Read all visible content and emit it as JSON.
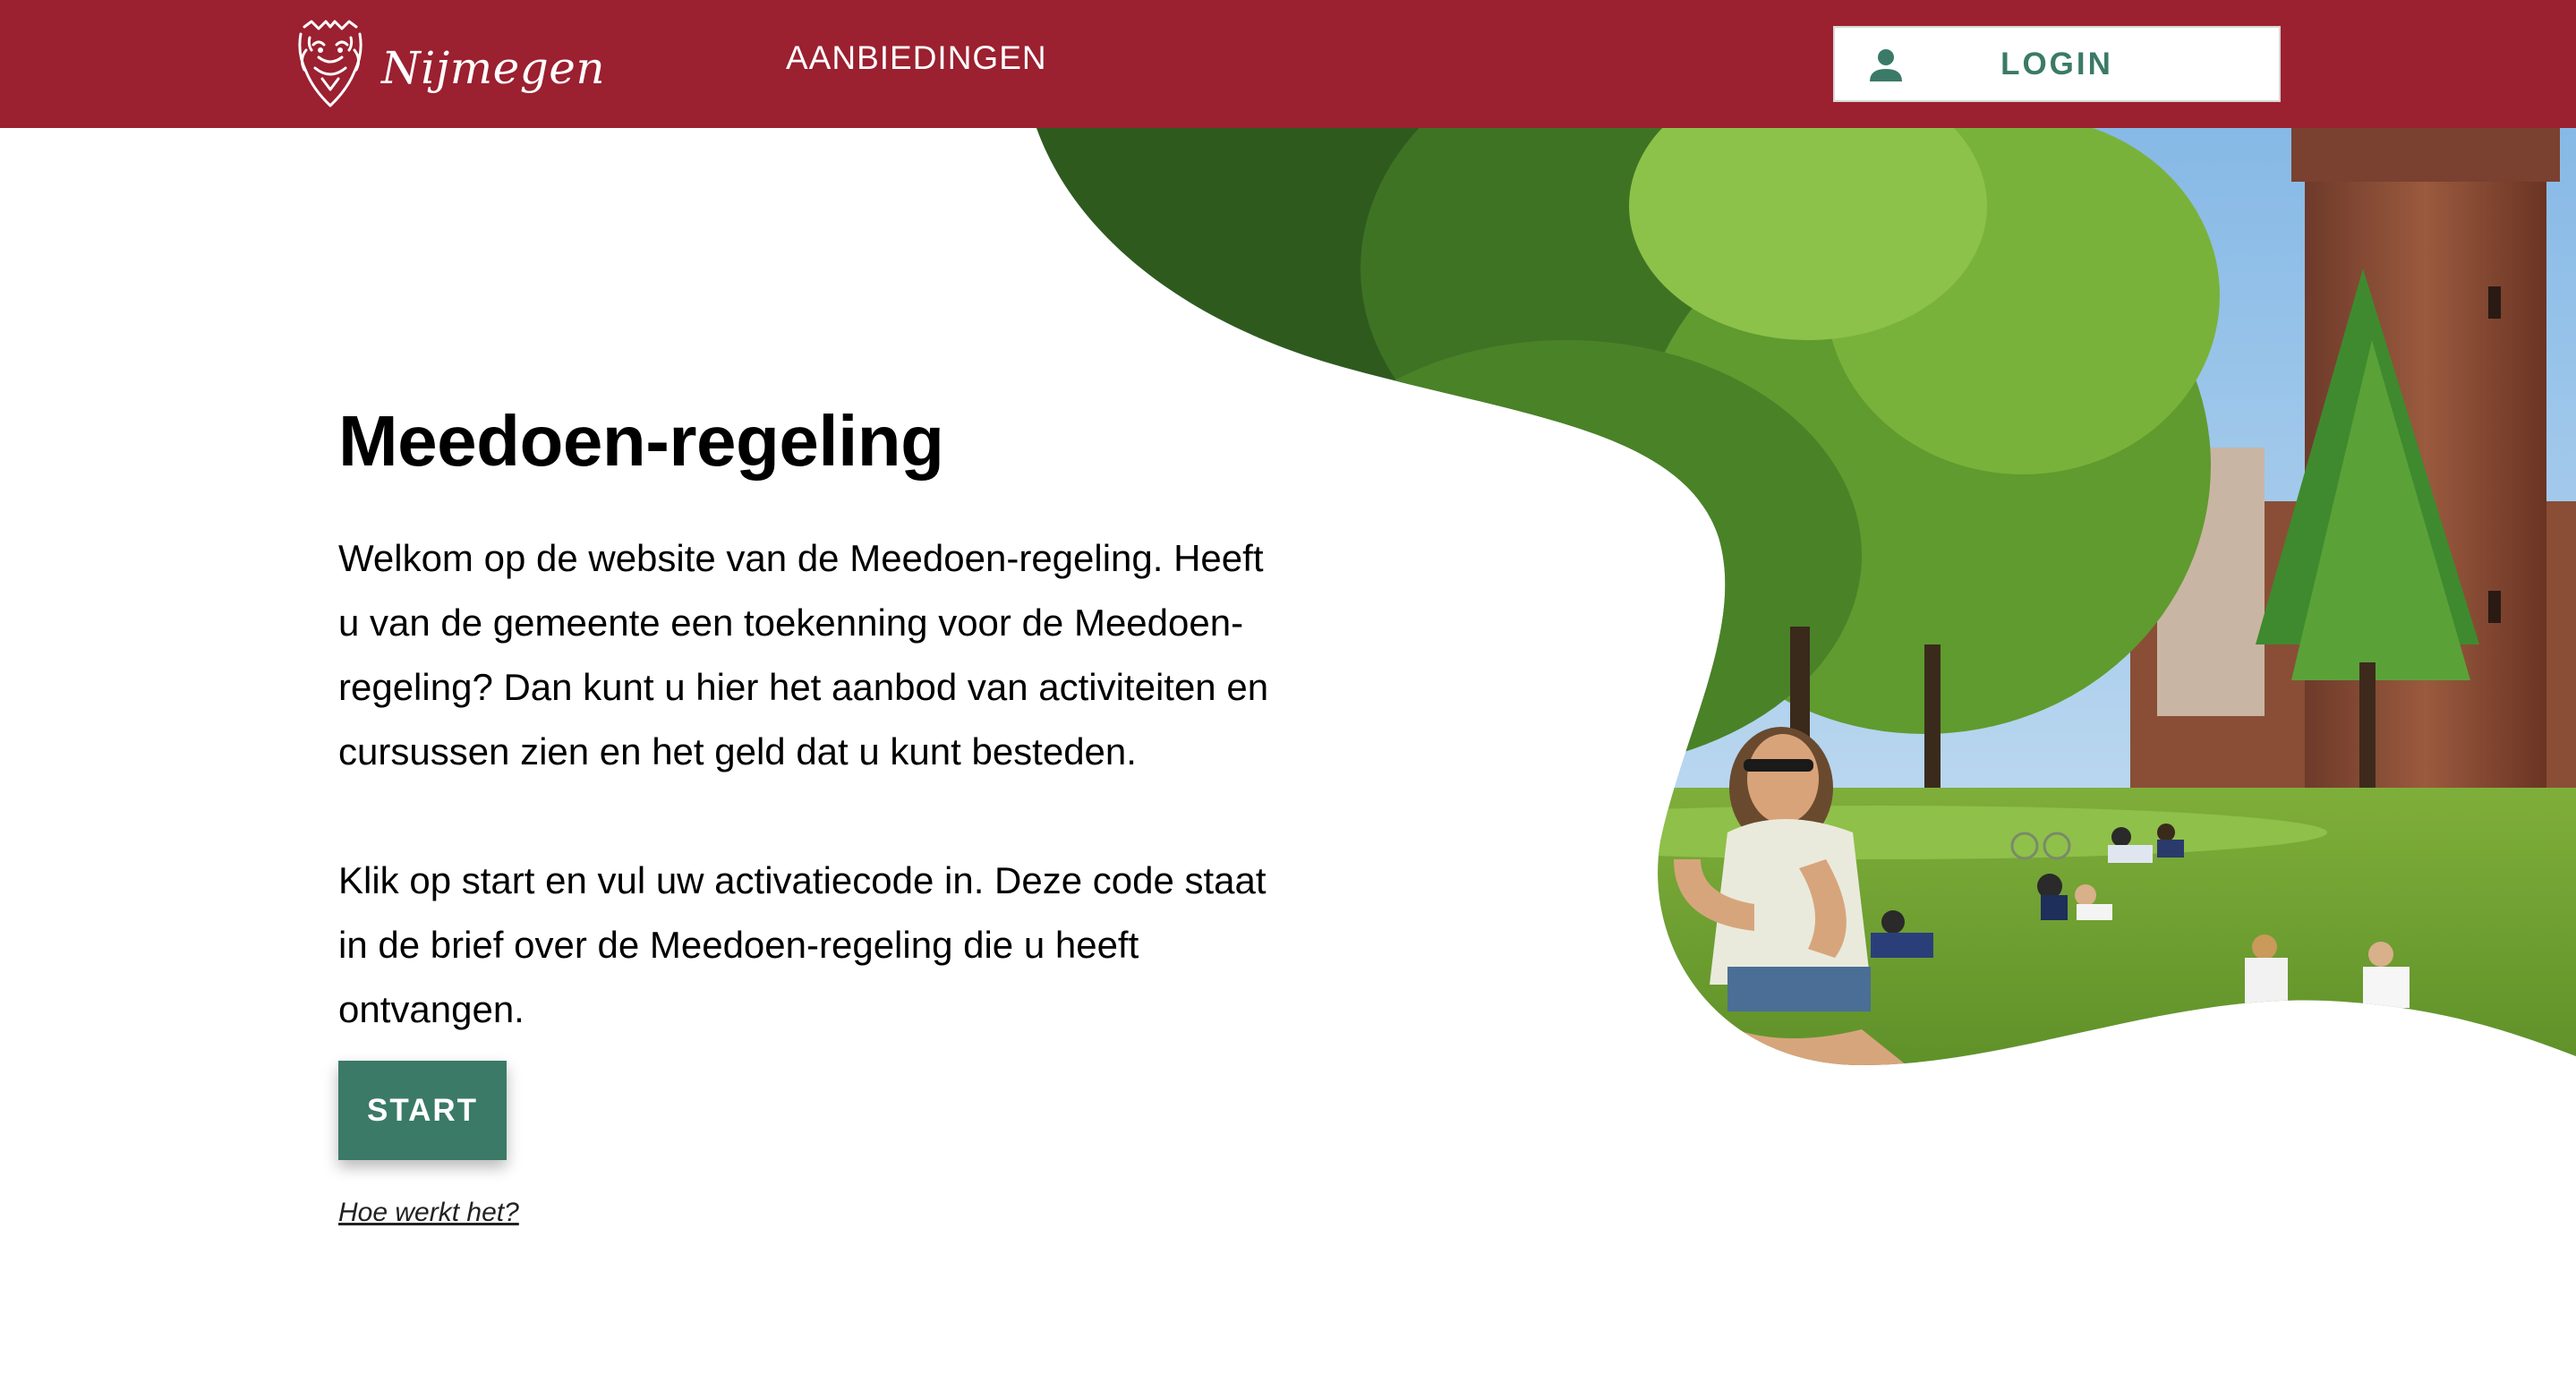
{
  "header": {
    "brand_name": "Nijmegen",
    "logo_icon": "lion-crest-icon",
    "nav_offers_label": "AANBIEDINGEN",
    "login_label": "LOGIN",
    "login_icon": "person-icon"
  },
  "main": {
    "title": "Meedoen-regeling",
    "intro_paragraphs": [
      "Welkom op de website van de Meedoen-regeling. Heeft u van de gemeente een toekenning voor de Meedoen-regeling? Dan kunt u hier het aanbod van activiteiten en cursussen zien en het geld dat u kunt besteden.",
      "Klik op start en vul uw activatiecode in. Deze code staat in de brief over de Meedoen-regeling die u heeft ontvangen."
    ],
    "start_label": "START",
    "howto_link": "Hoe werkt het?"
  },
  "colors": {
    "header_bg": "#9b2030",
    "accent_green": "#3a7a66",
    "text": "#000000",
    "background": "#ffffff"
  }
}
